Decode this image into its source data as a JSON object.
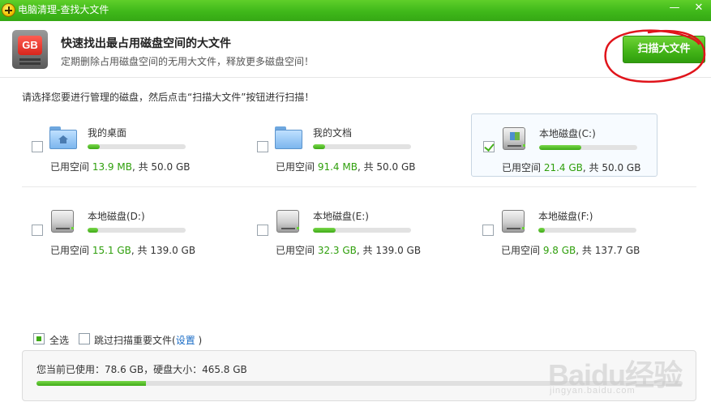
{
  "window": {
    "title": "电脑清理-查找大文件",
    "minimize": "—",
    "close": "✕"
  },
  "header": {
    "icon_label": "GB",
    "title": "快速找出最占用磁盘空间的大文件",
    "subtitle": "定期删除占用磁盘空间的无用大文件，释放更多磁盘空间！",
    "scan_button": "扫描大文件",
    "annotation_color": "#e0141b"
  },
  "instruction": "请选择您要进行管理的磁盘，然后点击“扫描大文件”按钮进行扫描！",
  "usage_prefix": "已用空间 ",
  "usage_sep": ", 共 ",
  "disks": [
    {
      "name": "我的桌面",
      "icon": "desktop-folder-icon",
      "used": "13.9 MB",
      "total": "50.0 GB",
      "fill": 0.12,
      "checked": false
    },
    {
      "name": "我的文档",
      "icon": "documents-folder-icon",
      "used": "91.4 MB",
      "total": "50.0 GB",
      "fill": 0.12,
      "checked": false
    },
    {
      "name": "本地磁盘(C:)",
      "icon": "system-drive-icon",
      "used": "21.4 GB",
      "total": "50.0 GB",
      "fill": 0.43,
      "checked": true
    },
    {
      "name": "本地磁盘(D:)",
      "icon": "drive-icon",
      "used": "15.1 GB",
      "total": "139.0 GB",
      "fill": 0.11,
      "checked": false
    },
    {
      "name": "本地磁盘(E:)",
      "icon": "drive-icon",
      "used": "32.3 GB",
      "total": "139.0 GB",
      "fill": 0.23,
      "checked": false
    },
    {
      "name": "本地磁盘(F:)",
      "icon": "drive-icon",
      "used": "9.8 GB",
      "total": "137.7 GB",
      "fill": 0.07,
      "checked": false
    }
  ],
  "options": {
    "select_all": "全选",
    "skip_label": "跳过扫描重要文件(",
    "settings_link": "设置",
    "skip_close": " )"
  },
  "footer": {
    "summary": "您当前已使用：78.6 GB，硬盘大小：465.8 GB",
    "fill": 0.17
  },
  "watermark": {
    "logo": "Baidu经验",
    "url": "jingyan.baidu.com"
  },
  "colors": {
    "title_bar": "#3fb81a",
    "accent_green": "#3eaa16",
    "link_blue": "#1a6cc6"
  }
}
